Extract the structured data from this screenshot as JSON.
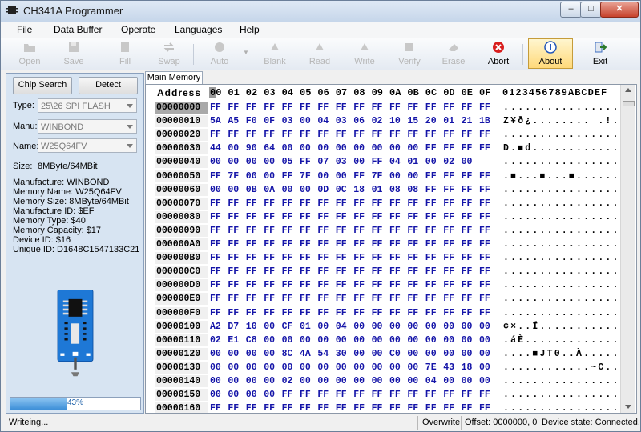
{
  "window": {
    "title": "CH341A Programmer"
  },
  "menu": [
    "File",
    "Data Buffer",
    "Operate",
    "Languages",
    "Help"
  ],
  "toolbar": [
    {
      "label": "Open",
      "icon": "folder-icon",
      "enabled": false
    },
    {
      "label": "Save",
      "icon": "floppy-icon",
      "enabled": false
    },
    {
      "label": "Fill",
      "icon": "fill-icon",
      "enabled": false
    },
    {
      "label": "Swap",
      "icon": "swap-icon",
      "enabled": false
    },
    {
      "label": "Auto",
      "icon": "auto-icon",
      "enabled": false
    },
    {
      "label": "Blank",
      "icon": "blank-icon",
      "enabled": false
    },
    {
      "label": "Read",
      "icon": "read-icon",
      "enabled": false
    },
    {
      "label": "Write",
      "icon": "write-icon",
      "enabled": false
    },
    {
      "label": "Verify",
      "icon": "verify-icon",
      "enabled": false
    },
    {
      "label": "Erase",
      "icon": "erase-icon",
      "enabled": false
    },
    {
      "label": "Abort",
      "icon": "stop-icon",
      "enabled": true
    },
    {
      "label": "About",
      "icon": "info-icon",
      "enabled": true,
      "active": true
    },
    {
      "label": "Exit",
      "icon": "exit-icon",
      "enabled": true
    }
  ],
  "left": {
    "chip_search": "Chip Search",
    "detect": "Detect",
    "type_label": "Type:",
    "type_value": "25\\26 SPI FLASH",
    "manu_label": "Manu:",
    "manu_value": "WINBOND",
    "name_label": "Name:",
    "name_value": "W25Q64FV",
    "size_label": "Size:",
    "size_value": "8MByte/64MBit",
    "info": [
      "Manufacture: WINBOND",
      "Memory Name: W25Q64FV",
      "Memory Size: 8MByte/64MBit",
      "Manufacture ID: $EF",
      "Memory Type: $40",
      "Memory Capacity: $17",
      "Device ID: $16",
      "Unique ID: D1648C1547133C21"
    ],
    "progress_percent": 43,
    "progress_text": "43%"
  },
  "tab": "Main Memory",
  "hex": {
    "address_header": "Address",
    "columns": [
      "00",
      "01",
      "02",
      "03",
      "04",
      "05",
      "06",
      "07",
      "08",
      "09",
      "0A",
      "0B",
      "0C",
      "0D",
      "0E",
      "0F"
    ],
    "ascii_header": "0123456789ABCDEF",
    "rows": [
      {
        "addr": "00000000",
        "bytes": [
          "FF",
          "FF",
          "FF",
          "FF",
          "FF",
          "FF",
          "FF",
          "FF",
          "FF",
          "FF",
          "FF",
          "FF",
          "FF",
          "FF",
          "FF",
          "FF"
        ],
        "ascii": "................"
      },
      {
        "addr": "00000010",
        "bytes": [
          "5A",
          "A5",
          "F0",
          "0F",
          "03",
          "00",
          "04",
          "03",
          "06",
          "02",
          "10",
          "15",
          "20",
          "01",
          "21",
          "1B"
        ],
        "ascii": "Z¥ð¿........ .!."
      },
      {
        "addr": "00000020",
        "bytes": [
          "FF",
          "FF",
          "FF",
          "FF",
          "FF",
          "FF",
          "FF",
          "FF",
          "FF",
          "FF",
          "FF",
          "FF",
          "FF",
          "FF",
          "FF",
          "FF"
        ],
        "ascii": "................"
      },
      {
        "addr": "00000030",
        "bytes": [
          "44",
          "00",
          "90",
          "64",
          "00",
          "00",
          "00",
          "00",
          "00",
          "00",
          "00",
          "00",
          "FF",
          "FF",
          "FF",
          "FF"
        ],
        "ascii": "D.■d............"
      },
      {
        "addr": "00000040",
        "bytes": [
          "00",
          "00",
          "00",
          "00",
          "05",
          "FF",
          "07",
          "03",
          "00",
          "FF",
          "04",
          "01",
          "00",
          "02",
          "00"
        ],
        "ascii": "................"
      },
      {
        "addr": "00000050",
        "bytes": [
          "FF",
          "7F",
          "00",
          "00",
          "FF",
          "7F",
          "00",
          "00",
          "FF",
          "7F",
          "00",
          "00",
          "FF",
          "FF",
          "FF",
          "FF"
        ],
        "ascii": ".■...■...■......"
      },
      {
        "addr": "00000060",
        "bytes": [
          "00",
          "00",
          "0B",
          "0A",
          "00",
          "00",
          "0D",
          "0C",
          "18",
          "01",
          "08",
          "08",
          "FF",
          "FF",
          "FF",
          "FF"
        ],
        "ascii": "................"
      },
      {
        "addr": "00000070",
        "bytes": [
          "FF",
          "FF",
          "FF",
          "FF",
          "FF",
          "FF",
          "FF",
          "FF",
          "FF",
          "FF",
          "FF",
          "FF",
          "FF",
          "FF",
          "FF",
          "FF"
        ],
        "ascii": "................"
      },
      {
        "addr": "00000080",
        "bytes": [
          "FF",
          "FF",
          "FF",
          "FF",
          "FF",
          "FF",
          "FF",
          "FF",
          "FF",
          "FF",
          "FF",
          "FF",
          "FF",
          "FF",
          "FF",
          "FF"
        ],
        "ascii": "................"
      },
      {
        "addr": "00000090",
        "bytes": [
          "FF",
          "FF",
          "FF",
          "FF",
          "FF",
          "FF",
          "FF",
          "FF",
          "FF",
          "FF",
          "FF",
          "FF",
          "FF",
          "FF",
          "FF",
          "FF"
        ],
        "ascii": "................"
      },
      {
        "addr": "000000A0",
        "bytes": [
          "FF",
          "FF",
          "FF",
          "FF",
          "FF",
          "FF",
          "FF",
          "FF",
          "FF",
          "FF",
          "FF",
          "FF",
          "FF",
          "FF",
          "FF",
          "FF"
        ],
        "ascii": "................"
      },
      {
        "addr": "000000B0",
        "bytes": [
          "FF",
          "FF",
          "FF",
          "FF",
          "FF",
          "FF",
          "FF",
          "FF",
          "FF",
          "FF",
          "FF",
          "FF",
          "FF",
          "FF",
          "FF",
          "FF"
        ],
        "ascii": "................"
      },
      {
        "addr": "000000C0",
        "bytes": [
          "FF",
          "FF",
          "FF",
          "FF",
          "FF",
          "FF",
          "FF",
          "FF",
          "FF",
          "FF",
          "FF",
          "FF",
          "FF",
          "FF",
          "FF",
          "FF"
        ],
        "ascii": "................"
      },
      {
        "addr": "000000D0",
        "bytes": [
          "FF",
          "FF",
          "FF",
          "FF",
          "FF",
          "FF",
          "FF",
          "FF",
          "FF",
          "FF",
          "FF",
          "FF",
          "FF",
          "FF",
          "FF",
          "FF"
        ],
        "ascii": "................"
      },
      {
        "addr": "000000E0",
        "bytes": [
          "FF",
          "FF",
          "FF",
          "FF",
          "FF",
          "FF",
          "FF",
          "FF",
          "FF",
          "FF",
          "FF",
          "FF",
          "FF",
          "FF",
          "FF",
          "FF"
        ],
        "ascii": "................"
      },
      {
        "addr": "000000F0",
        "bytes": [
          "FF",
          "FF",
          "FF",
          "FF",
          "FF",
          "FF",
          "FF",
          "FF",
          "FF",
          "FF",
          "FF",
          "FF",
          "FF",
          "FF",
          "FF",
          "FF"
        ],
        "ascii": "................"
      },
      {
        "addr": "00000100",
        "bytes": [
          "A2",
          "D7",
          "10",
          "00",
          "CF",
          "01",
          "00",
          "04",
          "00",
          "00",
          "00",
          "00",
          "00",
          "00",
          "00",
          "00"
        ],
        "ascii": "¢×..Ï..........."
      },
      {
        "addr": "00000110",
        "bytes": [
          "02",
          "E1",
          "C8",
          "00",
          "00",
          "00",
          "00",
          "00",
          "00",
          "00",
          "00",
          "00",
          "00",
          "00",
          "00",
          "00"
        ],
        "ascii": ".áÈ............."
      },
      {
        "addr": "00000120",
        "bytes": [
          "00",
          "00",
          "00",
          "00",
          "8C",
          "4A",
          "54",
          "30",
          "00",
          "00",
          "C0",
          "00",
          "00",
          "00",
          "00",
          "00"
        ],
        "ascii": "....■JT0..À....."
      },
      {
        "addr": "00000130",
        "bytes": [
          "00",
          "00",
          "00",
          "00",
          "00",
          "00",
          "00",
          "00",
          "00",
          "00",
          "00",
          "00",
          "7E",
          "43",
          "18",
          "00"
        ],
        "ascii": "............~C.."
      },
      {
        "addr": "00000140",
        "bytes": [
          "00",
          "00",
          "00",
          "00",
          "02",
          "00",
          "00",
          "00",
          "00",
          "00",
          "00",
          "00",
          "04",
          "00",
          "00",
          "00"
        ],
        "ascii": "................"
      },
      {
        "addr": "00000150",
        "bytes": [
          "00",
          "00",
          "00",
          "00",
          "FF",
          "FF",
          "FF",
          "FF",
          "FF",
          "FF",
          "FF",
          "FF",
          "FF",
          "FF",
          "FF",
          "FF"
        ],
        "ascii": "................"
      },
      {
        "addr": "00000160",
        "bytes": [
          "FF",
          "FF",
          "FF",
          "FF",
          "FF",
          "FF",
          "FF",
          "FF",
          "FF",
          "FF",
          "FF",
          "FF",
          "FF",
          "FF",
          "FF",
          "FF"
        ],
        "ascii": "................"
      }
    ]
  },
  "status": {
    "message": "Writeing...",
    "mode": "Overwrite",
    "offset": "Offset: 0000000, 0",
    "device": "Device state: Connected."
  }
}
